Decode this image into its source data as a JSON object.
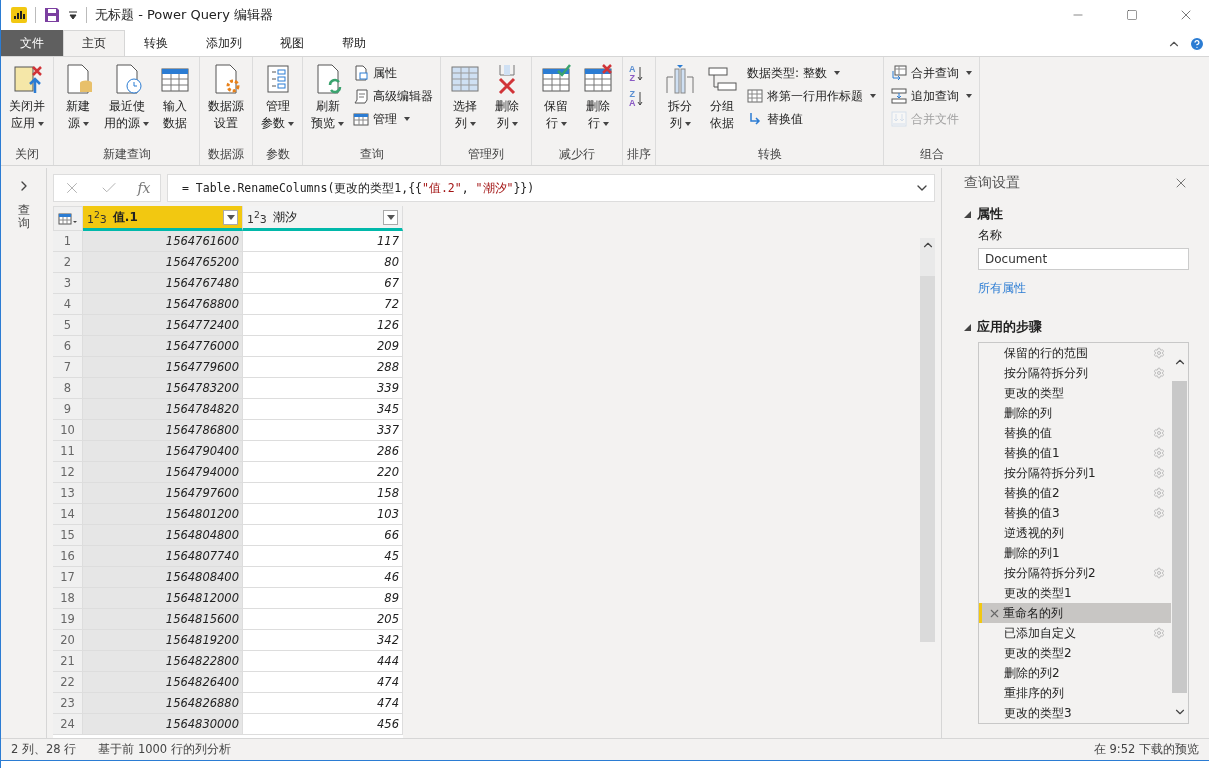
{
  "window": {
    "title": "无标题 - Power Query 编辑器"
  },
  "tabs": [
    {
      "label": "文件",
      "kind": "file",
      "selected": false
    },
    {
      "label": "主页",
      "kind": "tab",
      "selected": true
    },
    {
      "label": "转换",
      "kind": "tab",
      "selected": false
    },
    {
      "label": "添加列",
      "kind": "tab",
      "selected": false
    },
    {
      "label": "视图",
      "kind": "tab",
      "selected": false
    },
    {
      "label": "帮助",
      "kind": "tab",
      "selected": false
    }
  ],
  "ribbon": {
    "groups": [
      {
        "label": "关闭",
        "items": [
          {
            "kind": "large",
            "lines": [
              "关闭并",
              "应用"
            ],
            "dropdown": true
          }
        ]
      },
      {
        "label": "新建查询",
        "items": [
          {
            "kind": "large",
            "lines": [
              "新建",
              "源"
            ],
            "dropdown": true
          },
          {
            "kind": "large",
            "lines": [
              "最近使",
              "用的源"
            ],
            "dropdown": true
          },
          {
            "kind": "large",
            "lines": [
              "输入",
              "数据"
            ],
            "dropdown": false
          }
        ]
      },
      {
        "label": "数据源",
        "items": [
          {
            "kind": "large",
            "lines": [
              "数据源",
              "设置"
            ],
            "dropdown": false
          }
        ]
      },
      {
        "label": "参数",
        "items": [
          {
            "kind": "large",
            "lines": [
              "管理",
              "参数"
            ],
            "dropdown": true
          }
        ]
      },
      {
        "label": "查询",
        "items": [
          {
            "kind": "large",
            "lines": [
              "刷新",
              "预览"
            ],
            "dropdown": true
          },
          {
            "kind": "small",
            "lines": [
              "属性"
            ],
            "dropdown": false
          },
          {
            "kind": "small",
            "lines": [
              "高级编辑器"
            ],
            "dropdown": false
          },
          {
            "kind": "small",
            "lines": [
              "管理"
            ],
            "dropdown": true
          }
        ]
      },
      {
        "label": "管理列",
        "items": [
          {
            "kind": "large",
            "lines": [
              "选择",
              "列"
            ],
            "dropdown": true
          },
          {
            "kind": "large",
            "lines": [
              "删除",
              "列"
            ],
            "dropdown": true
          }
        ]
      },
      {
        "label": "减少行",
        "items": [
          {
            "kind": "large",
            "lines": [
              "保留",
              "行"
            ],
            "dropdown": true
          },
          {
            "kind": "large",
            "lines": [
              "删除",
              "行"
            ],
            "dropdown": true
          }
        ]
      },
      {
        "label": "排序",
        "items": [
          {
            "kind": "sort",
            "lines": [
              "A",
              "Z"
            ]
          },
          {
            "kind": "sort",
            "lines": [
              "Z",
              "A"
            ]
          }
        ]
      },
      {
        "label": "转换",
        "items": [
          {
            "kind": "large",
            "lines": [
              "拆分",
              "列"
            ],
            "dropdown": true
          },
          {
            "kind": "large",
            "lines": [
              "分组",
              "依据"
            ],
            "dropdown": false
          },
          {
            "kind": "small",
            "lines": [
              "数据类型: 整数"
            ],
            "dropdown": true
          },
          {
            "kind": "small",
            "lines": [
              "将第一行用作标题"
            ],
            "dropdown": true
          },
          {
            "kind": "small",
            "lines": [
              "替换值"
            ],
            "dropdown": false
          }
        ]
      },
      {
        "label": "组合",
        "items": [
          {
            "kind": "small",
            "lines": [
              "合并查询"
            ],
            "dropdown": true,
            "disabled": false
          },
          {
            "kind": "small",
            "lines": [
              "追加查询"
            ],
            "dropdown": true,
            "disabled": false
          },
          {
            "kind": "small",
            "lines": [
              "合并文件"
            ],
            "dropdown": false,
            "disabled": true
          }
        ]
      }
    ]
  },
  "queries_pane": {
    "label": "查询",
    "expanded": false
  },
  "formula_bar": {
    "fx": "fx",
    "parts": [
      {
        "kind": "code",
        "text": "= Table.RenameColumns(更改的类型1,{{"
      },
      {
        "kind": "string",
        "text": "\"值.2\""
      },
      {
        "kind": "code",
        "text": ", "
      },
      {
        "kind": "string",
        "text": "\"潮汐\""
      },
      {
        "kind": "code",
        "text": "}})"
      }
    ]
  },
  "table": {
    "columns": [
      {
        "type": "1$^{2}$3",
        "label": "值.1",
        "selected": true
      },
      {
        "type": "1$^{2}$3",
        "label": "潮汐",
        "selected": false
      }
    ],
    "rows": [
      [
        "1",
        "1564761600",
        "117"
      ],
      [
        "2",
        "1564765200",
        "80"
      ],
      [
        "3",
        "1564767480",
        "67"
      ],
      [
        "4",
        "1564768800",
        "72"
      ],
      [
        "5",
        "1564772400",
        "126"
      ],
      [
        "6",
        "1564776000",
        "209"
      ],
      [
        "7",
        "1564779600",
        "288"
      ],
      [
        "8",
        "1564783200",
        "339"
      ],
      [
        "9",
        "1564784820",
        "345"
      ],
      [
        "10",
        "1564786800",
        "337"
      ],
      [
        "11",
        "1564790400",
        "286"
      ],
      [
        "12",
        "1564794000",
        "220"
      ],
      [
        "13",
        "1564797600",
        "158"
      ],
      [
        "14",
        "1564801200",
        "103"
      ],
      [
        "15",
        "1564804800",
        "66"
      ],
      [
        "16",
        "1564807740",
        "45"
      ],
      [
        "17",
        "1564808400",
        "46"
      ],
      [
        "18",
        "1564812000",
        "89"
      ],
      [
        "19",
        "1564815600",
        "205"
      ],
      [
        "20",
        "1564819200",
        "342"
      ],
      [
        "21",
        "1564822800",
        "444"
      ],
      [
        "22",
        "1564826400",
        "474"
      ],
      [
        "23",
        "1564826880",
        "474"
      ],
      [
        "24",
        "1564830000",
        "456"
      ]
    ]
  },
  "query_settings": {
    "title": "查询设置",
    "properties": {
      "heading": "属性",
      "name_label": "名称",
      "name_value": "Document",
      "link": "所有属性"
    },
    "steps_heading": "应用的步骤",
    "steps": [
      {
        "label": "保留的行的范围",
        "has_settings": true,
        "selected": false
      },
      {
        "label": "按分隔符拆分列",
        "has_settings": true,
        "selected": false
      },
      {
        "label": "更改的类型",
        "has_settings": false,
        "selected": false
      },
      {
        "label": "删除的列",
        "has_settings": false,
        "selected": false
      },
      {
        "label": "替换的值",
        "has_settings": true,
        "selected": false
      },
      {
        "label": "替换的值1",
        "has_settings": true,
        "selected": false
      },
      {
        "label": "按分隔符拆分列1",
        "has_settings": true,
        "selected": false
      },
      {
        "label": "替换的值2",
        "has_settings": true,
        "selected": false
      },
      {
        "label": "替换的值3",
        "has_settings": true,
        "selected": false
      },
      {
        "label": "逆透视的列",
        "has_settings": false,
        "selected": false
      },
      {
        "label": "删除的列1",
        "has_settings": false,
        "selected": false
      },
      {
        "label": "按分隔符拆分列2",
        "has_settings": true,
        "selected": false
      },
      {
        "label": "更改的类型1",
        "has_settings": false,
        "selected": false
      },
      {
        "label": "重命名的列",
        "has_settings": false,
        "selected": true
      },
      {
        "label": "已添加自定义",
        "has_settings": true,
        "selected": false
      },
      {
        "label": "更改的类型2",
        "has_settings": false,
        "selected": false
      },
      {
        "label": "删除的列2",
        "has_settings": false,
        "selected": false
      },
      {
        "label": "重排序的列",
        "has_settings": false,
        "selected": false
      },
      {
        "label": "更改的类型3",
        "has_settings": false,
        "selected": false
      }
    ]
  },
  "status_bar": {
    "counts": "2 列、28 行",
    "profiling": "基于前 1000 行的列分析",
    "preview": "在 9:52 下载的预览"
  }
}
